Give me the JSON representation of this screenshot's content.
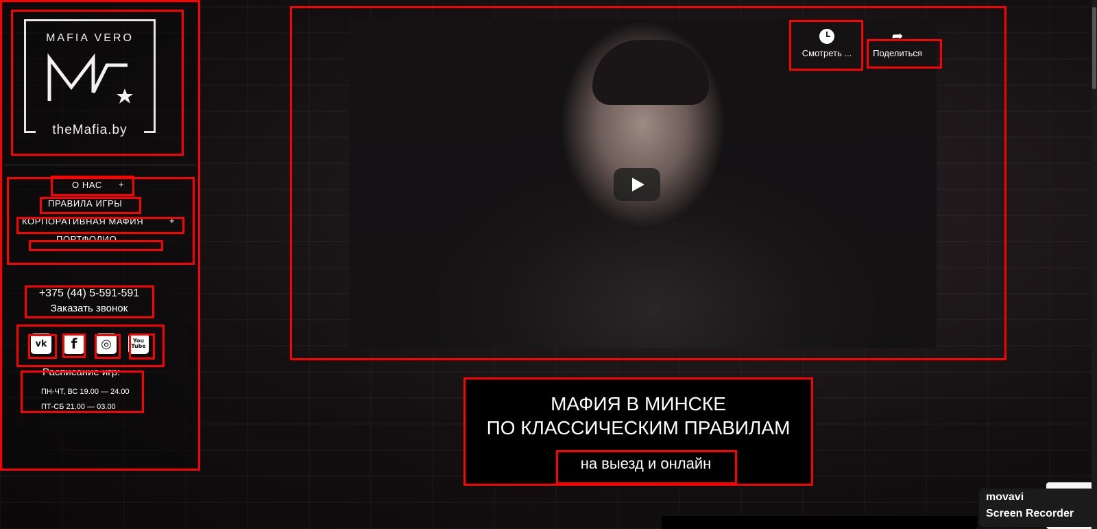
{
  "logo": {
    "top_text": "MAFIA VERO",
    "bottom_text": "theMafia.by"
  },
  "menu": {
    "items": [
      {
        "label": "О НАС",
        "plus": "+"
      },
      {
        "label": "ПРАВИЛА ИГРЫ"
      },
      {
        "label": "КОРПОРАТИВНАЯ МАФИЯ",
        "plus": "+"
      },
      {
        "label": "ПОРТФОЛИО"
      }
    ]
  },
  "contact": {
    "phone": "+375 (44) 5-591-591",
    "callback": "Заказать звонок"
  },
  "social": {
    "vk": "vk",
    "facebook": "f",
    "instagram": "◎",
    "youtube": "You Tube"
  },
  "schedule": {
    "title": "Расписание игр:",
    "rows": [
      "ПН-ЧТ, ВС  19.00 — 24.00",
      "ПТ-СБ  21.00 — 03.00"
    ]
  },
  "video": {
    "watch_later": "Смотреть ...",
    "share": "Поделиться"
  },
  "headline": {
    "line1": "МАФИЯ В МИНСКЕ",
    "line2": "ПО КЛАССИЧЕСКИМ ПРАВИЛАМ",
    "sub": "на выезд и онлайн"
  },
  "recorder": {
    "brand": "movavi",
    "label": "Screen Recorder"
  },
  "annotation_color": "#ff0000"
}
